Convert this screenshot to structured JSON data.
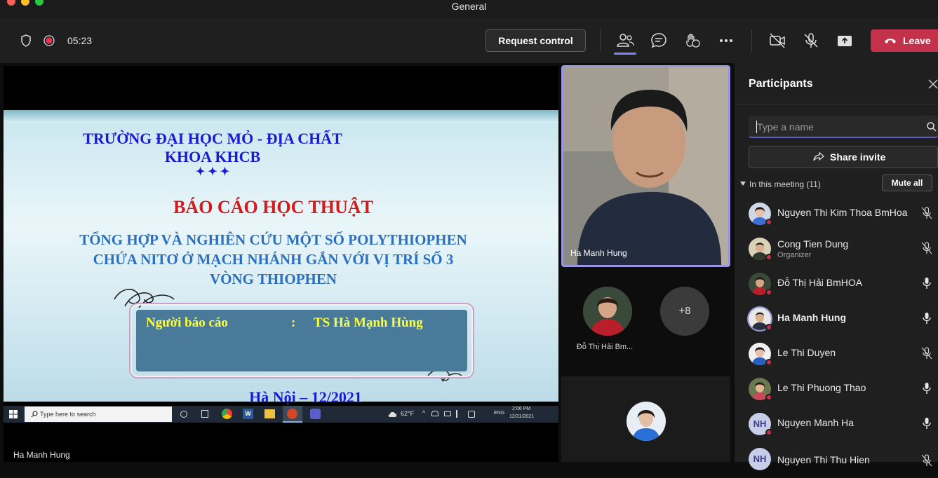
{
  "window": {
    "title": "General"
  },
  "toolbar": {
    "timer": "05:23",
    "request_control_label": "Request control",
    "leave_label": "Leave"
  },
  "slide": {
    "line1": "TRƯỜNG ĐẠI HỌC MỎ - ĐỊA CHẤT",
    "line2": "KHOA KHCB",
    "stars": "✦ ✦ ✦",
    "heading": "BÁO CÁO HỌC THUẬT",
    "topic1": "TỔNG HỢP VÀ NGHIÊN CỨU MỘT SỐ POLYTHIOPHEN",
    "topic2": "CHỨA NITƠ Ở MẠCH NHÁNH GẮN VỚI VỊ TRÍ SỐ 3",
    "topic3": "VÒNG THIOPHEN",
    "presenter_label": "Người báo cáo",
    "presenter_colon": ":",
    "presenter_name": "TS Hà Mạnh Hùng",
    "place_date": "Hà Nội – 12/2021"
  },
  "taskbar": {
    "search_placeholder": "Type here to search",
    "weather": "62°F",
    "lang": "ENG",
    "time": "2:06 PM",
    "date": "12/31/2021"
  },
  "stage": {
    "presenter_name": "Ha Manh Hung"
  },
  "video_tile": {
    "name": "Ha Manh Hung"
  },
  "gallery": {
    "mini_name": "Đỗ Thị Hải Bm...",
    "overflow_count": "+8"
  },
  "participants_panel": {
    "title": "Participants",
    "search_placeholder": "Type a name",
    "share_invite_label": "Share invite",
    "in_meeting_label": "In this meeting (11)",
    "mute_all_label": "Mute all",
    "people": [
      {
        "name": "Nguyen Thi Kim Thoa BmHoa",
        "role": "",
        "mic": "muted"
      },
      {
        "name": "Cong Tien Dung",
        "role": "Organizer",
        "mic": "muted"
      },
      {
        "name": "Đỗ Thị Hải BmHOA",
        "role": "",
        "mic": "on"
      },
      {
        "name": "Ha Manh Hung",
        "role": "",
        "mic": "on"
      },
      {
        "name": "Le Thi Duyen",
        "role": "",
        "mic": "muted"
      },
      {
        "name": "Le Thi Phuong Thao",
        "role": "",
        "mic": "on"
      },
      {
        "name": "Nguyen Manh Ha",
        "initials": "NH",
        "role": "",
        "mic": "on"
      },
      {
        "name": "Nguyen Thi Thu Hien",
        "initials": "NH",
        "role": "",
        "mic": "muted"
      }
    ]
  },
  "colors": {
    "leave_red": "#c4314b",
    "accent_purple": "#7f85f5",
    "slide_blue_title": "#1a1ad6",
    "slide_red_heading": "#d61a1a",
    "slide_topic_blue": "#2a6fc0"
  }
}
